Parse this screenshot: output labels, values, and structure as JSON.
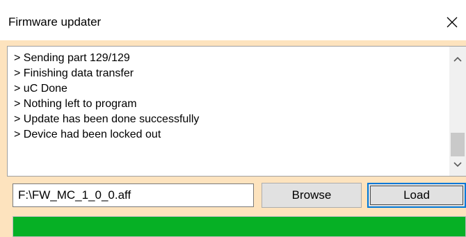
{
  "window": {
    "title": "Firmware updater"
  },
  "log": {
    "lines": [
      "> Sending part 129/129",
      "> Finishing data transfer",
      "> uC Done",
      "> Nothing left to program",
      "> Update has been done successfully",
      "> Device had been locked out"
    ]
  },
  "file": {
    "path": "F:\\FW_MC_1_0_0.aff"
  },
  "buttons": {
    "browse_label": "Browse",
    "load_label": "Load"
  },
  "progress": {
    "fraction": 1.0,
    "color": "#06b025"
  },
  "icons": {
    "close": "close-icon",
    "scroll_up": "chevron-up-icon",
    "scroll_down": "chevron-down-icon"
  }
}
